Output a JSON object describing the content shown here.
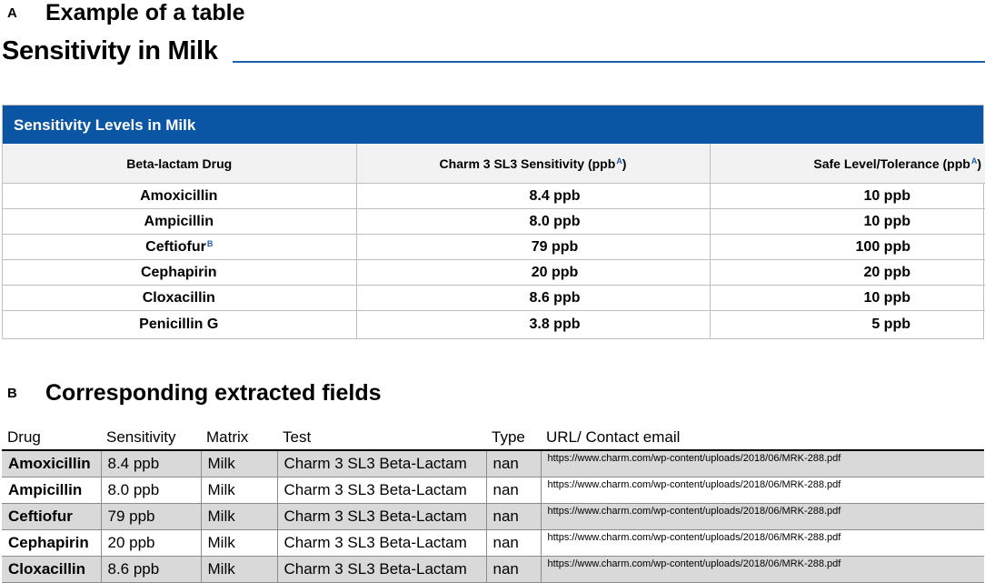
{
  "panel_a": {
    "letter": "A",
    "title": "Example of a table",
    "heading": "Sensitivity in Milk",
    "table_title": "Sensitivity Levels in Milk",
    "columns": [
      {
        "label": "Beta-lactam Drug",
        "sup": ""
      },
      {
        "label": "Charm 3 SL3 Sensitivity (ppb",
        "sup": "A",
        "close": ")"
      },
      {
        "label": "Safe Level/Tolerance (ppb",
        "sup": "A",
        "close": ")"
      }
    ],
    "rows": [
      {
        "drug": "Amoxicillin",
        "sup": "",
        "sensitivity": "8.4 ppb",
        "tolerance": "10 ppb"
      },
      {
        "drug": "Ampicillin",
        "sup": "",
        "sensitivity": "8.0 ppb",
        "tolerance": "10 ppb"
      },
      {
        "drug": "Ceftiofur",
        "sup": "B",
        "sensitivity": "79 ppb",
        "tolerance": "100 ppb"
      },
      {
        "drug": "Cephapirin",
        "sup": "",
        "sensitivity": "20 ppb",
        "tolerance": "20 ppb"
      },
      {
        "drug": "Cloxacillin",
        "sup": "",
        "sensitivity": "8.6 ppb",
        "tolerance": "10 ppb"
      },
      {
        "drug": "Penicillin G",
        "sup": "",
        "sensitivity": "3.8 ppb",
        "tolerance": "5 ppb"
      }
    ]
  },
  "panel_b": {
    "letter": "B",
    "title": "Corresponding extracted fields",
    "columns": [
      "Drug",
      "Sensitivity",
      "Matrix",
      "Test",
      "Type",
      "URL/ Contact email"
    ],
    "rows": [
      {
        "drug": "Amoxicillin",
        "sensitivity": "8.4 ppb",
        "matrix": "Milk",
        "test": "Charm 3 SL3 Beta-Lactam",
        "type": "nan",
        "url": "https://www.charm.com/wp-content/uploads/2018/06/MRK-288.pdf"
      },
      {
        "drug": "Ampicillin",
        "sensitivity": "8.0 ppb",
        "matrix": "Milk",
        "test": "Charm 3 SL3 Beta-Lactam",
        "type": "nan",
        "url": "https://www.charm.com/wp-content/uploads/2018/06/MRK-288.pdf"
      },
      {
        "drug": "Ceftiofur",
        "sensitivity": "79 ppb",
        "matrix": "Milk",
        "test": "Charm 3 SL3 Beta-Lactam",
        "type": "nan",
        "url": "https://www.charm.com/wp-content/uploads/2018/06/MRK-288.pdf"
      },
      {
        "drug": "Cephapirin",
        "sensitivity": "20 ppb",
        "matrix": "Milk",
        "test": "Charm 3 SL3 Beta-Lactam",
        "type": "nan",
        "url": "https://www.charm.com/wp-content/uploads/2018/06/MRK-288.pdf"
      },
      {
        "drug": "Cloxacillin",
        "sensitivity": "8.6 ppb",
        "matrix": "Milk",
        "test": "Charm 3 SL3 Beta-Lactam",
        "type": "nan",
        "url": "https://www.charm.com/wp-content/uploads/2018/06/MRK-288.pdf"
      }
    ]
  }
}
